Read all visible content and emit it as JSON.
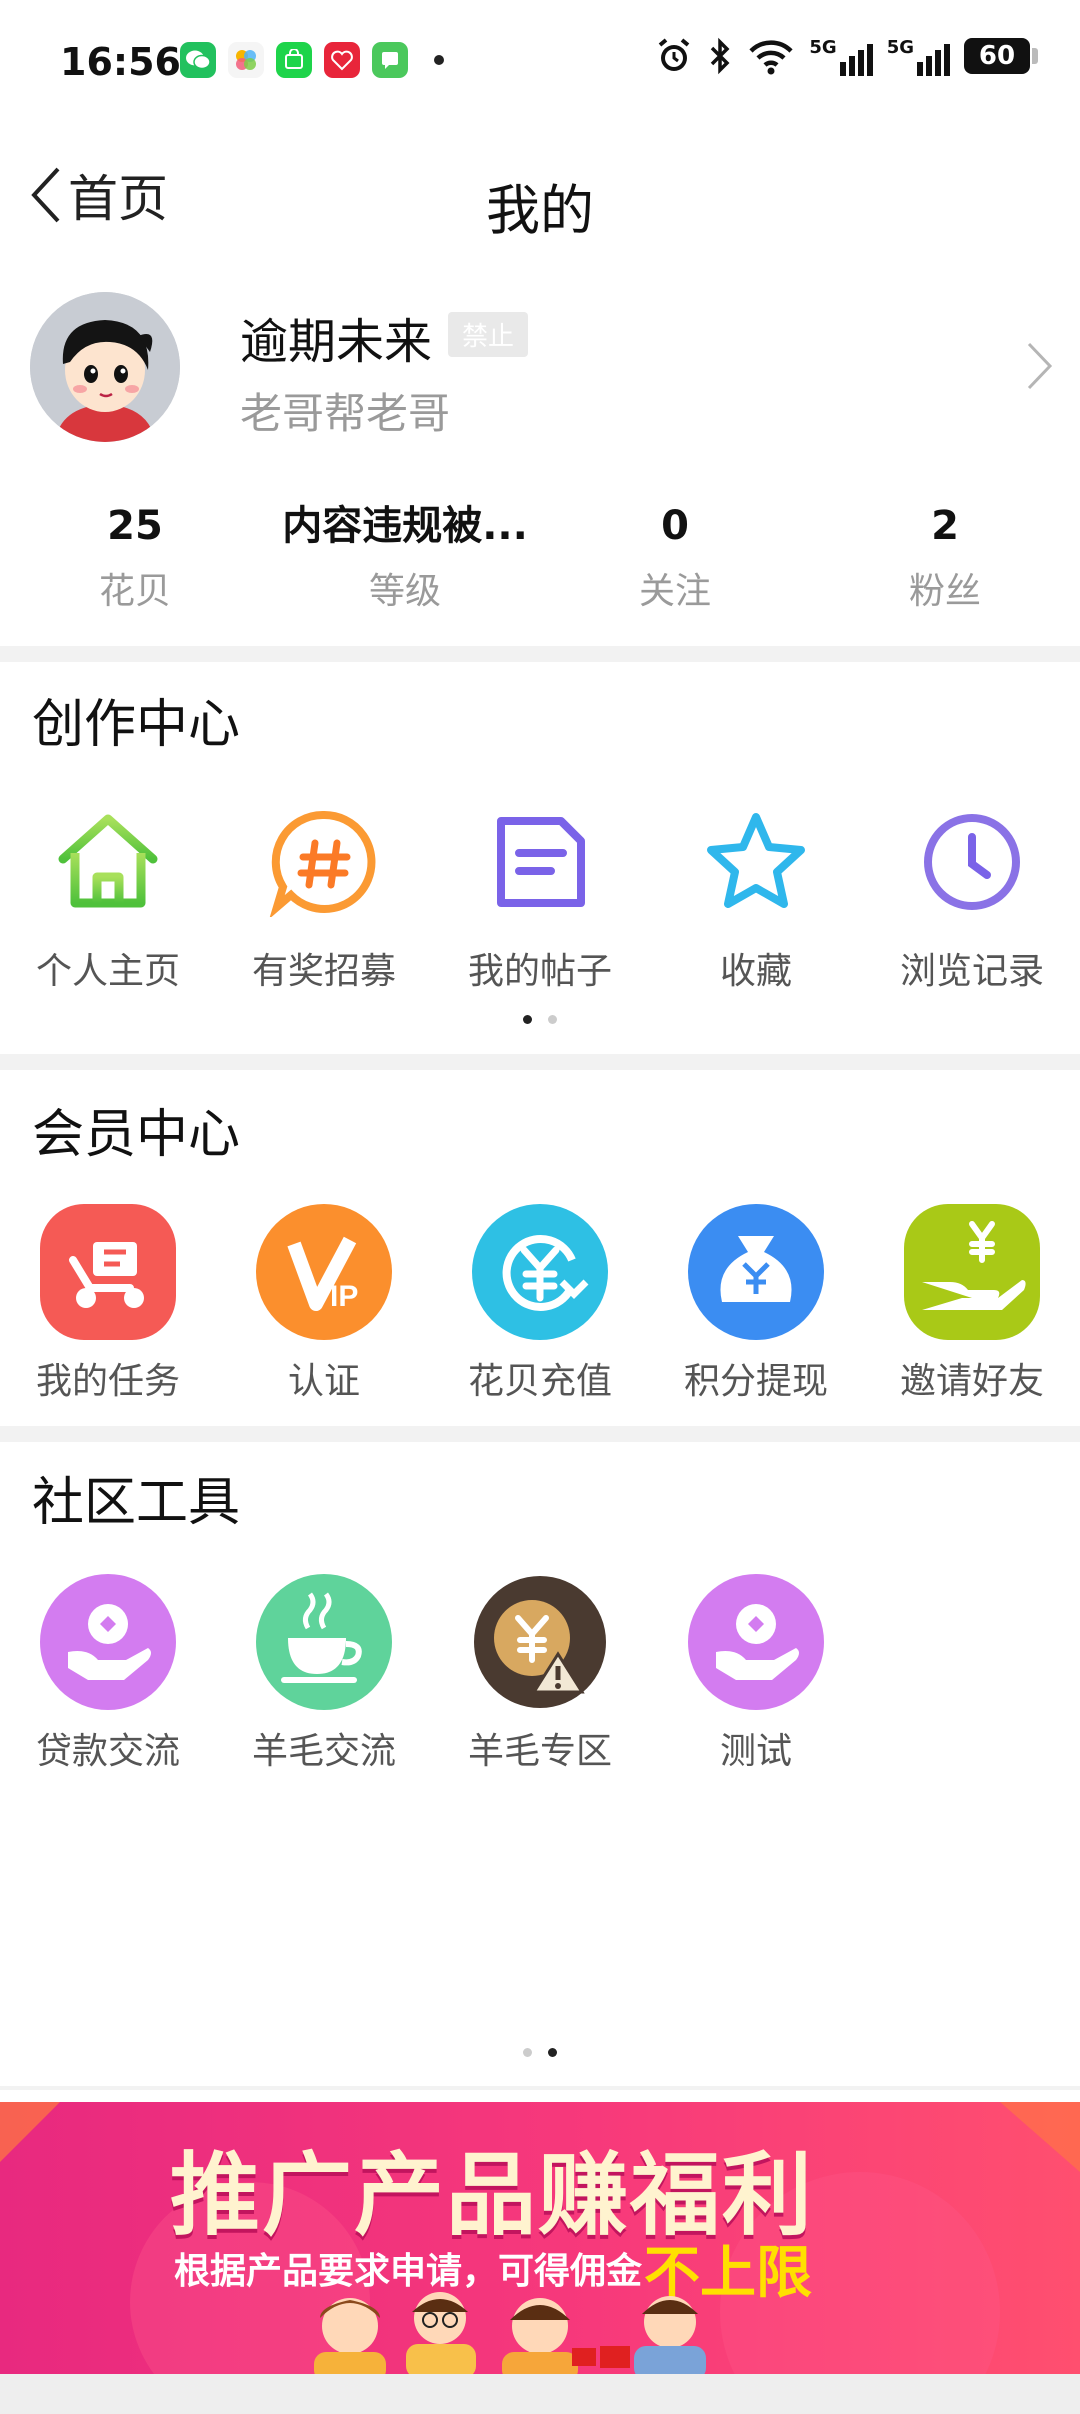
{
  "status_bar": {
    "time": "16:56",
    "network_1": "5G",
    "network_2": "5G",
    "battery": "60"
  },
  "nav": {
    "back_label": "首页",
    "title": "我的"
  },
  "profile": {
    "username": "逾期未来",
    "badge": "禁止",
    "signature": "老哥帮老哥"
  },
  "stats": [
    {
      "value": "25",
      "label": "花贝"
    },
    {
      "value": "内容违规被...",
      "label": "等级"
    },
    {
      "value": "0",
      "label": "关注"
    },
    {
      "value": "2",
      "label": "粉丝"
    }
  ],
  "creation_center": {
    "title": "创作中心",
    "items": [
      {
        "label": "个人主页",
        "icon": "home-icon"
      },
      {
        "label": "有奖招募",
        "icon": "hashtag-icon"
      },
      {
        "label": "我的帖子",
        "icon": "document-icon"
      },
      {
        "label": "收藏",
        "icon": "star-icon"
      },
      {
        "label": "浏览记录",
        "icon": "clock-icon"
      }
    ]
  },
  "member_center": {
    "title": "会员中心",
    "items": [
      {
        "label": "我的任务",
        "icon": "task-scooter-icon",
        "color": "#f55a55"
      },
      {
        "label": "认证",
        "icon": "vip-icon",
        "color": "#fb8f2d"
      },
      {
        "label": "花贝充值",
        "icon": "yuan-recharge-icon",
        "color": "#2ec0e4"
      },
      {
        "label": "积分提现",
        "icon": "money-bag-icon",
        "color": "#3b8df2"
      },
      {
        "label": "邀请好友",
        "icon": "hand-yuan-icon",
        "color": "#a9c917"
      }
    ]
  },
  "community_tools": {
    "title": "社区工具",
    "items": [
      {
        "label": "贷款交流",
        "icon": "loan-hand-icon",
        "color": "#d37cf0"
      },
      {
        "label": "羊毛交流",
        "icon": "coffee-cup-icon",
        "color": "#5fd39b"
      },
      {
        "label": "羊毛专区",
        "icon": "yuan-warning-icon",
        "color": "#4a3a30"
      },
      {
        "label": "测试",
        "icon": "loan-hand-icon",
        "color": "#d37cf0"
      }
    ]
  },
  "banner": {
    "title": "推广产品赚福利",
    "subtitle": "根据产品要求申请，可得佣金",
    "highlight": "不上限"
  }
}
